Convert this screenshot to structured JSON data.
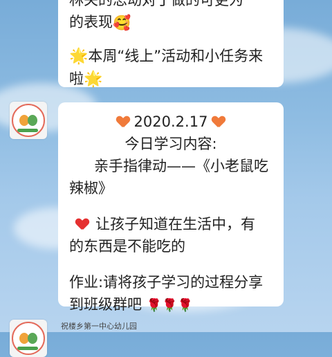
{
  "prev_message": {
    "line1": "林关的思动对丁做的可更为",
    "line2": "的表现",
    "line2_emoji": "🥰",
    "line3_prefix": "🌟",
    "line3_text": "本周“线上”活动和小任务来",
    "line4_text": "啦",
    "line4_suffix": "🌟"
  },
  "message": {
    "date": "2020.2.17",
    "heading": "今日学习内容:",
    "content_line1": "亲手指律动——《小老鼠吃",
    "content_line2": "辣椒》",
    "point_line1": "让孩子知道在生活中，有",
    "point_line2": "的东西是不能吃的",
    "homework_line1": "作业:请将孩子学习的过程分享",
    "homework_line2": "到班级群吧",
    "roses": "🌹🌹🌹"
  },
  "next_sender": "祝楼乡第一中心幼儿园",
  "colors": {
    "bubble": "#ffffff",
    "sky_top": "#78acd8",
    "sky_bottom": "#b7d4ef"
  }
}
